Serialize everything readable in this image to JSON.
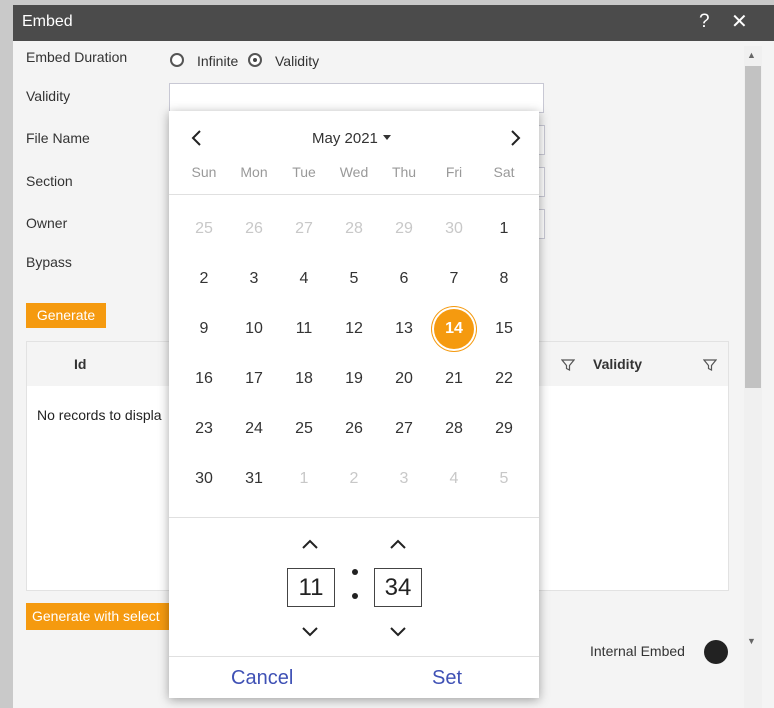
{
  "dialog": {
    "title": "Embed",
    "help_label": "?",
    "close_label": "✕"
  },
  "form": {
    "embed_duration_label": "Embed Duration",
    "option_infinite": "Infinite",
    "option_validity": "Validity",
    "selected_option": "Validity",
    "validity_label": "Validity",
    "validity_value": "",
    "file_name_label": "File Name",
    "section_label": "Section",
    "owner_label": "Owner",
    "bypass_label": "Bypass"
  },
  "buttons": {
    "generate": "Generate",
    "generate_selected": "Generate with select"
  },
  "grid": {
    "columns": [
      "Id",
      "Validity"
    ],
    "empty_text": "No records to displa"
  },
  "footer": {
    "internal_embed_label": "Internal Embed"
  },
  "datepicker": {
    "month_label": "May 2021",
    "weekdays": [
      "Sun",
      "Mon",
      "Tue",
      "Wed",
      "Thu",
      "Fri",
      "Sat"
    ],
    "weeks": [
      [
        25,
        26,
        27,
        28,
        29,
        30,
        1
      ],
      [
        2,
        3,
        4,
        5,
        6,
        7,
        8
      ],
      [
        9,
        10,
        11,
        12,
        13,
        14,
        15
      ],
      [
        16,
        17,
        18,
        19,
        20,
        21,
        22
      ],
      [
        23,
        24,
        25,
        26,
        27,
        28,
        29
      ],
      [
        30,
        31,
        1,
        2,
        3,
        4,
        5
      ]
    ],
    "selected_day": 14,
    "hour": "11",
    "minute": "34",
    "cancel_label": "Cancel",
    "set_label": "Set"
  },
  "colors": {
    "accent": "#f59a0f",
    "titlebar": "#4b4b4b",
    "link": "#3f51b5"
  },
  "icons": [
    "help-icon",
    "close-icon",
    "filter-icon",
    "chevron-left-icon",
    "chevron-right-icon",
    "caret-down-icon",
    "chevron-up-icon",
    "chevron-down-icon",
    "embed-icon"
  ]
}
